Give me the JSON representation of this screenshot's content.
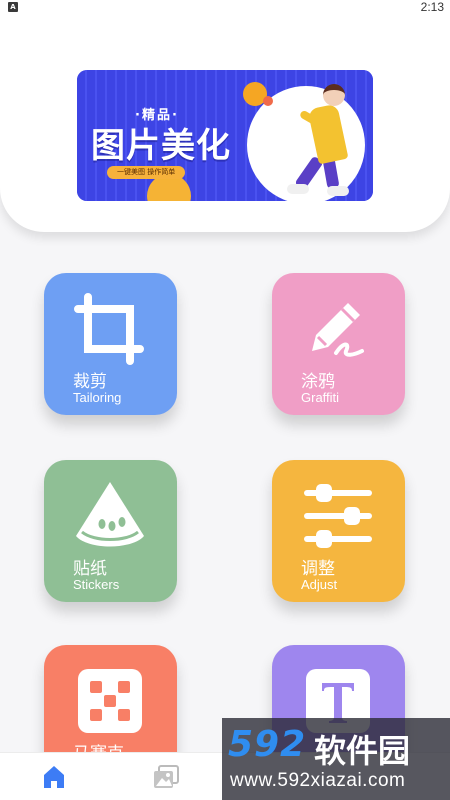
{
  "status_bar": {
    "notification_glyph": "A",
    "time": "2:13"
  },
  "banner": {
    "tag": "·精品·",
    "title": "图片美化",
    "subtitle": "一键美图 操作简单"
  },
  "tiles": [
    {
      "id": "crop",
      "title": "裁剪",
      "subtitle": "Tailoring",
      "color": "#6e9ff3",
      "icon": "crop-icon"
    },
    {
      "id": "graffiti",
      "title": "涂鸦",
      "subtitle": "Graffiti",
      "color": "#f09ec6",
      "icon": "pen-icon"
    },
    {
      "id": "stickers",
      "title": "贴纸",
      "subtitle": "Stickers",
      "color": "#8fbf95",
      "icon": "watermelon-icon"
    },
    {
      "id": "adjust",
      "title": "调整",
      "subtitle": "Adjust",
      "color": "#f5b63f",
      "icon": "sliders-icon"
    },
    {
      "id": "mosaic",
      "title": "马赛克",
      "subtitle": "",
      "color": "#f87f66",
      "icon": "mosaic-icon"
    },
    {
      "id": "text",
      "title": "",
      "subtitle": "",
      "color": "#9e86ee",
      "icon": "text-icon"
    }
  ],
  "bottom_nav": {
    "items": [
      {
        "name": "home",
        "icon": "home-icon",
        "active": true,
        "active_color": "#3d7cf5"
      },
      {
        "name": "gallery",
        "icon": "gallery-icon",
        "active": false
      }
    ]
  },
  "watermark": {
    "logo_num": "592",
    "logo_cn": "软件园",
    "url": "www.592xiazai.com"
  }
}
